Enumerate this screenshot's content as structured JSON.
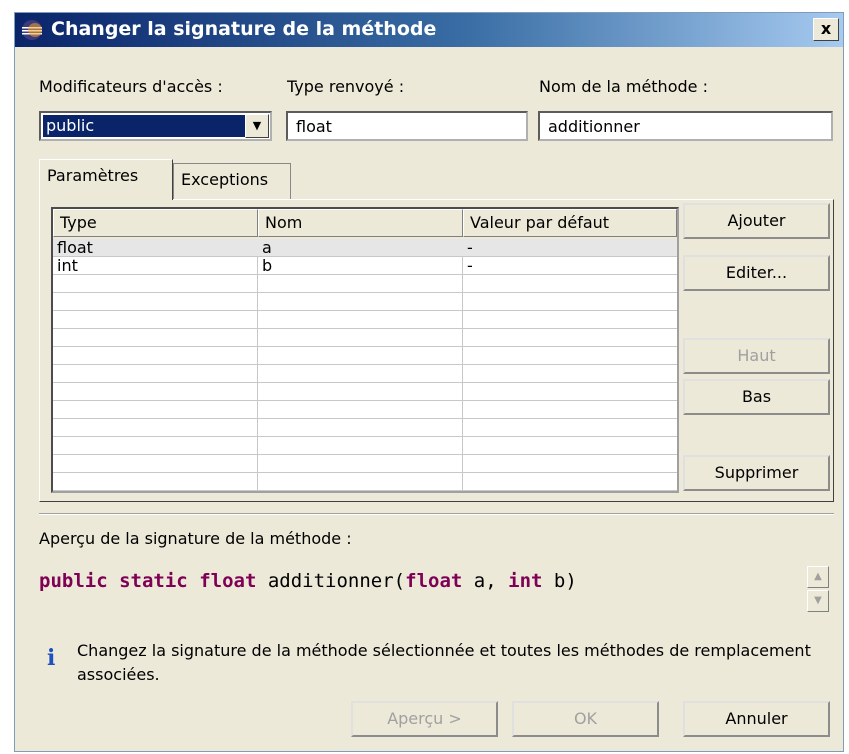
{
  "window": {
    "title": "Changer la signature de la méthode",
    "close_label": "x"
  },
  "fields": {
    "access_label": "Modificateurs d'accès :",
    "access_value": "public",
    "return_label": "Type renvoyé :",
    "return_value": "float",
    "name_label": "Nom de la méthode :",
    "name_value": "additionner"
  },
  "tabs": [
    "Paramètres",
    "Exceptions"
  ],
  "table": {
    "columns": [
      "Type",
      "Nom",
      "Valeur par défaut"
    ],
    "rows": [
      [
        "float",
        "a",
        "-"
      ],
      [
        "int",
        "b",
        "-"
      ]
    ]
  },
  "side_buttons": {
    "add": "Ajouter",
    "edit": "Editer...",
    "up": "Haut",
    "down": "Bas",
    "remove": "Supprimer"
  },
  "preview": {
    "label": "Aperçu de la signature de la méthode :",
    "kw_public": "public",
    "kw_static": "static",
    "kw_float": "float",
    "method": "additionner(",
    "kw_param1_type": "float",
    "param1": "a,",
    "kw_param2_type": "int",
    "param2": "b)"
  },
  "info": {
    "icon": "i",
    "text": "Changez la signature de la méthode sélectionnée et toutes les méthodes de remplacement associées."
  },
  "footer": {
    "preview": "Aperçu >",
    "ok": "OK",
    "cancel": "Annuler"
  },
  "colors": {
    "keyword": "#7f0055",
    "selection": "#0a246a",
    "dialog_bg": "#ece9d8"
  }
}
